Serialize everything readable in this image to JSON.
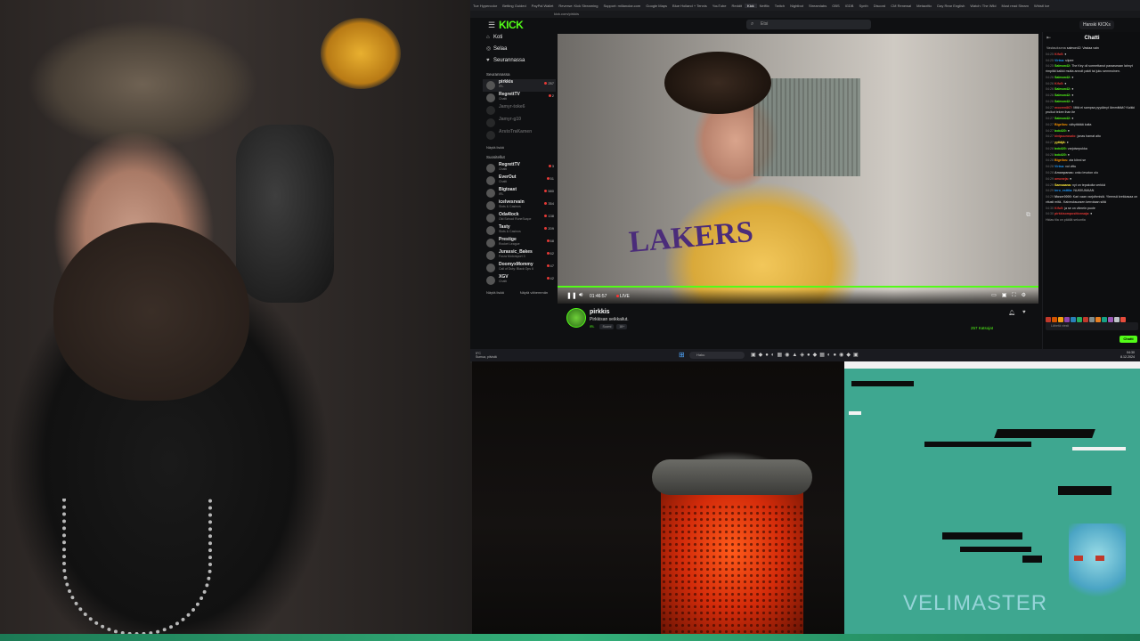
{
  "browser": {
    "tabs": [
      "Tue Hypercolor",
      "Betting Guided",
      "PayPal Wallet",
      "Reverse: Kick Streaming",
      "Support: millanolar.com",
      "Google Maps",
      "Blue Holland + Tennis",
      "YouTube",
      "Reddit",
      "Kick",
      "Netflix",
      "Twitch",
      "Nightbot",
      "Streamlabs",
      "OBS",
      "IGDB",
      "Synth",
      "Discord",
      "CM Renewal",
      "Metacritic",
      "Day Rear English",
      "Watch: The Wild",
      "Must read Steam",
      "Whistl Ice"
    ],
    "url": "kick.com/pirkkis"
  },
  "header": {
    "logo": "KICK",
    "search_placeholder": "Etsi",
    "login_label": "Hanski KICKs"
  },
  "sidebar": {
    "nav": [
      {
        "icon": "home-icon",
        "label": "Koti"
      },
      {
        "icon": "compass-icon",
        "label": "Selaa"
      },
      {
        "icon": "heart-icon",
        "label": "Seurannassa"
      }
    ],
    "following_title": "Seurannassa",
    "following": [
      {
        "name": "pirkkis",
        "sub": "IRL",
        "viewers": "257",
        "online": true,
        "selected": true
      },
      {
        "name": "RegrettTV",
        "sub": "Chatti",
        "viewers": "2",
        "online": true
      },
      {
        "name": "Jamyr-toke6",
        "sub": "",
        "viewers": "",
        "online": false
      },
      {
        "name": "Jamyr-g10",
        "sub": "",
        "viewers": "",
        "online": false
      },
      {
        "name": "ArstoTraKamen",
        "sub": "",
        "viewers": "",
        "online": false
      }
    ],
    "show_all_1": "Näytä lisää",
    "recommended_title": "Suositellut",
    "recommended": [
      {
        "name": "RegrettTV",
        "sub": "Chatti",
        "viewers": "3"
      },
      {
        "name": "EverOut",
        "sub": "Chatti",
        "viewers": "51"
      },
      {
        "name": "Bigtoast",
        "sub": "IRL",
        "viewers": "580"
      },
      {
        "name": "icelvesrvain",
        "sub": "Slots & Casinos",
        "viewers": "354"
      },
      {
        "name": "Oda4lock",
        "sub": "Old School RuneScape",
        "viewers": "138"
      },
      {
        "name": "Tasty",
        "sub": "Slots & Casinos",
        "viewers": "209"
      },
      {
        "name": "Prestige",
        "sub": "Rocket League",
        "viewers": "68"
      },
      {
        "name": "Jurassic_Bakes",
        "sub": "Forza Motorsport 3",
        "viewers": "62"
      },
      {
        "name": "DoomyxMommy",
        "sub": "Call of Duty: Black Ops 6",
        "viewers": "47"
      },
      {
        "name": "XGV",
        "sub": "Chatti",
        "viewers": "42"
      }
    ],
    "show_all_2": "Näytä lisää",
    "show_fewer": "Näytä vähemmän"
  },
  "player": {
    "time": "01:46:57",
    "live": "LIVE"
  },
  "streamer": {
    "name": "pirkkis",
    "title": "Pirkkisan seikkailut.",
    "category": "IRL",
    "tags": [
      "Suomi",
      "18+"
    ],
    "viewers": "257 Katsojat"
  },
  "chat": {
    "title": "Chatti",
    "messages": [
      {
        "ts": "",
        "user": "Vastauksena",
        "color": "#888",
        "text": "salmon42: Vastaa vain"
      },
      {
        "ts": "04:25",
        "user": "Kifu5:",
        "color": "#e53935",
        "text": "●"
      },
      {
        "ts": "04:25",
        "user": "Virtsa:",
        "color": "#2196f3",
        "text": "siipee"
      },
      {
        "ts": "04:25",
        "user": "Salmon42:",
        "color": "#53fc18",
        "text": "The Key oli sormettanut paraaveaan lahnyt rimpitäi kaikki mutta annoit pakti tai juku semmoinen."
      },
      {
        "ts": "04:26",
        "user": "Salmon42:",
        "color": "#53fc18",
        "text": "●"
      },
      {
        "ts": "04:26",
        "user": "Kifu5:",
        "color": "#e53935",
        "text": "●"
      },
      {
        "ts": "04:26",
        "user": "Salmon42:",
        "color": "#53fc18",
        "text": "●"
      },
      {
        "ts": "04:26",
        "user": "Salmon42:",
        "color": "#53fc18",
        "text": "●"
      },
      {
        "ts": "04:26",
        "user": "Salmon42:",
        "color": "#53fc18",
        "text": "●"
      },
      {
        "ts": "04:27",
        "user": "mooren867:",
        "color": "#e53935",
        "text": "Mitä ei sampsa pyydänyt lämmittää? Kaikki pruikut tekee ihan ite"
      },
      {
        "ts": "04:27",
        "user": "Salmon42:",
        "color": "#53fc18",
        "text": "●"
      },
      {
        "ts": "04:27",
        "user": "Bigellos:",
        "color": "#ff9800",
        "text": "vähyttätää kaita"
      },
      {
        "ts": "04:27",
        "user": "bob420:",
        "color": "#53fc18",
        "text": "●"
      },
      {
        "ts": "04:27",
        "user": "kivipuurosalo:",
        "color": "#e53935",
        "text": "jonas hamat aito"
      },
      {
        "ts": "04:27",
        "user": "yyttäjä:",
        "color": "#ffeb3b",
        "text": "●"
      },
      {
        "ts": "04:28",
        "user": "bob420:",
        "color": "#53fc18",
        "text": "varjoisepukka"
      },
      {
        "ts": "04:28",
        "user": "bob420:",
        "color": "#53fc18",
        "text": "●"
      },
      {
        "ts": "04:28",
        "user": "Bigellos:",
        "color": "#ff9800",
        "text": "ota kiinni se"
      },
      {
        "ts": "04:28",
        "user": "Virtsa:",
        "color": "#2196f3",
        "text": "voi vittu"
      },
      {
        "ts": "04:28",
        "user": "Amonpanas:",
        "color": "#bbb",
        "text": "onko levoton olo"
      },
      {
        "ts": "04:29",
        "user": "omoneja:",
        "color": "#e53935",
        "text": "●"
      },
      {
        "ts": "04:29",
        "user": "Samsaana:",
        "color": "#ffeb3b",
        "text": "nyt on tepakoita verkkä"
      },
      {
        "ts": "04:29",
        "user": "tero_esttila:",
        "color": "#2196f3",
        "text": "NUKKUMAAN"
      },
      {
        "ts": "04:29",
        "user": "Moser0000:",
        "color": "#bbb",
        "text": "Kari vaan varjoihmisiä. Yleensä krekkasaa on vitusti mitä.. Kaiveuksuosen kerrotaan siitä"
      },
      {
        "ts": "04:30",
        "user": "Kifu5:",
        "color": "#e53935",
        "text": "ja se on viimein puole"
      },
      {
        "ts": "04:30",
        "user": "pirkkisompositionsaja:",
        "color": "#e53935",
        "text": "●"
      }
    ],
    "notice": "Hidas tila on päällä sekuntia",
    "input_placeholder": "Lähetä viesti",
    "send_label": "Chatti"
  },
  "taskbar": {
    "weather": "5°C",
    "weather_sub": "Sumua, pilvistä",
    "search_placeholder": "Haku",
    "time": "04:30",
    "date": "8.12.2024"
  },
  "overlay": {
    "brand": "VELIMASTER"
  }
}
